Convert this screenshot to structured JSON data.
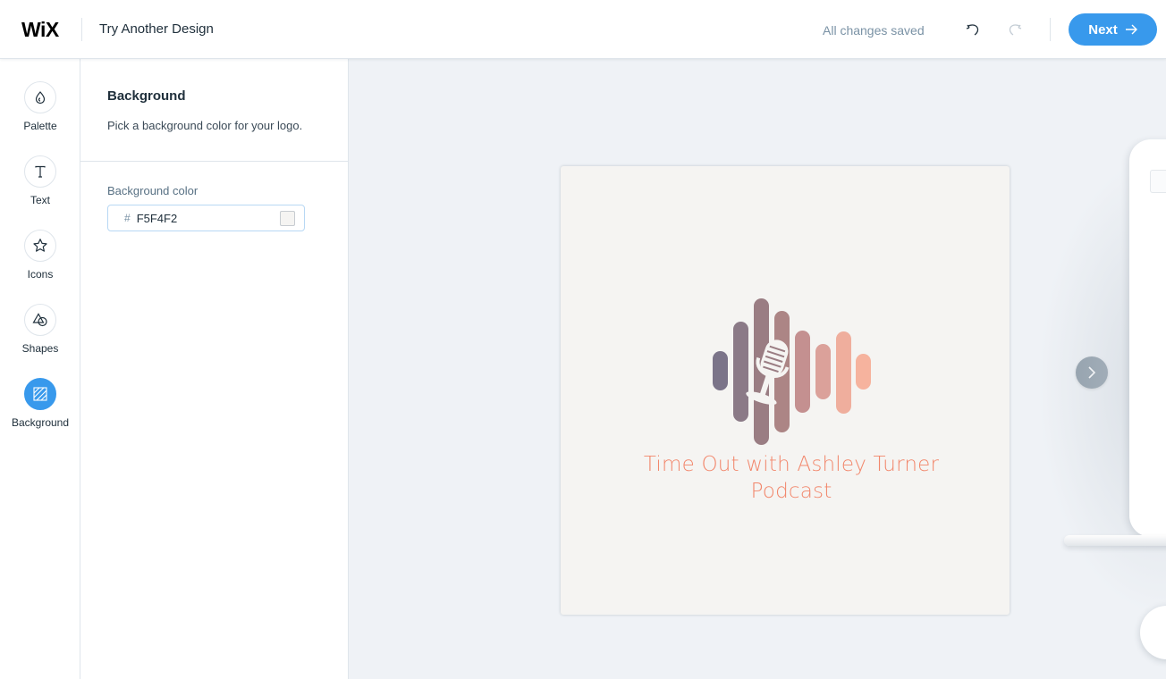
{
  "header": {
    "logo": "WiX",
    "title": "Try Another Design",
    "save_status": "All changes saved",
    "next_label": "Next"
  },
  "rail": {
    "items": [
      {
        "label": "Palette",
        "icon": "palette-icon"
      },
      {
        "label": "Text",
        "icon": "text-icon"
      },
      {
        "label": "Icons",
        "icon": "star-icon"
      },
      {
        "label": "Shapes",
        "icon": "shapes-icon"
      },
      {
        "label": "Background",
        "icon": "background-icon",
        "active": true
      }
    ]
  },
  "panel": {
    "title": "Background",
    "description": "Pick a background color for your logo.",
    "field_label": "Background color",
    "hash": "#",
    "color_value": "F5F4F2",
    "swatch_color": "#F5F4F2"
  },
  "canvas": {
    "background_color": "#F5F4F2",
    "logo_text_line1": "Time Out with Ashley Turner",
    "logo_text_line2": "Podcast",
    "text_color": "#F2876C",
    "bar_colors": [
      "#7b7489",
      "#8b7a87",
      "#9a7d83",
      "#ac8585",
      "#c49090",
      "#dba19a",
      "#efae9d",
      "#f6b39e"
    ]
  },
  "colors": {
    "accent": "#3899EC",
    "nav_button": "#8D9BA7"
  }
}
